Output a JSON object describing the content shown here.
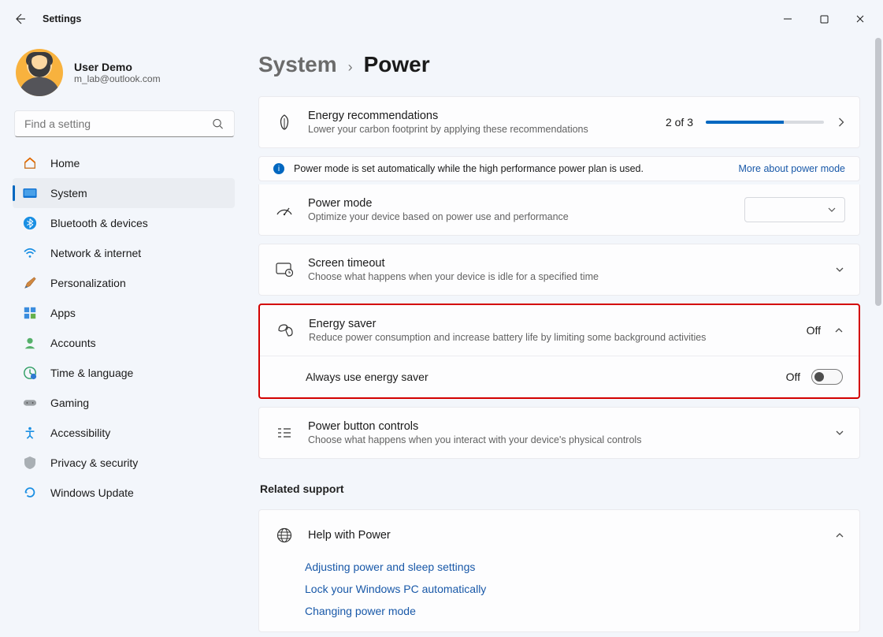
{
  "window": {
    "title": "Settings"
  },
  "user": {
    "name": "User Demo",
    "email": "m_lab@outlook.com"
  },
  "search": {
    "placeholder": "Find a setting"
  },
  "nav": [
    {
      "key": "home",
      "label": "Home"
    },
    {
      "key": "system",
      "label": "System"
    },
    {
      "key": "bluetooth",
      "label": "Bluetooth & devices"
    },
    {
      "key": "network",
      "label": "Network & internet"
    },
    {
      "key": "personalization",
      "label": "Personalization"
    },
    {
      "key": "apps",
      "label": "Apps"
    },
    {
      "key": "accounts",
      "label": "Accounts"
    },
    {
      "key": "time",
      "label": "Time & language"
    },
    {
      "key": "gaming",
      "label": "Gaming"
    },
    {
      "key": "accessibility",
      "label": "Accessibility"
    },
    {
      "key": "privacy",
      "label": "Privacy & security"
    },
    {
      "key": "update",
      "label": "Windows Update"
    }
  ],
  "breadcrumb": {
    "parent": "System",
    "current": "Power"
  },
  "energy_rec": {
    "title": "Energy recommendations",
    "sub": "Lower your carbon footprint by applying these recommendations",
    "count": "2 of 3",
    "progress_pct": 66
  },
  "info_banner": {
    "text": "Power mode is set automatically while the high performance power plan is used.",
    "link": "More about power mode"
  },
  "power_mode": {
    "title": "Power mode",
    "sub": "Optimize your device based on power use and performance",
    "value": ""
  },
  "screen_timeout": {
    "title": "Screen timeout",
    "sub": "Choose what happens when your device is idle for a specified time"
  },
  "energy_saver": {
    "title": "Energy saver",
    "sub": "Reduce power consumption and increase battery life by limiting some background activities",
    "status": "Off",
    "always_label": "Always use energy saver",
    "always_status": "Off"
  },
  "power_button": {
    "title": "Power button controls",
    "sub": "Choose what happens when you interact with your device's physical controls"
  },
  "related": {
    "heading": "Related support"
  },
  "help": {
    "title": "Help with Power",
    "links": [
      "Adjusting power and sleep settings",
      "Lock your Windows PC automatically",
      "Changing power mode"
    ]
  }
}
